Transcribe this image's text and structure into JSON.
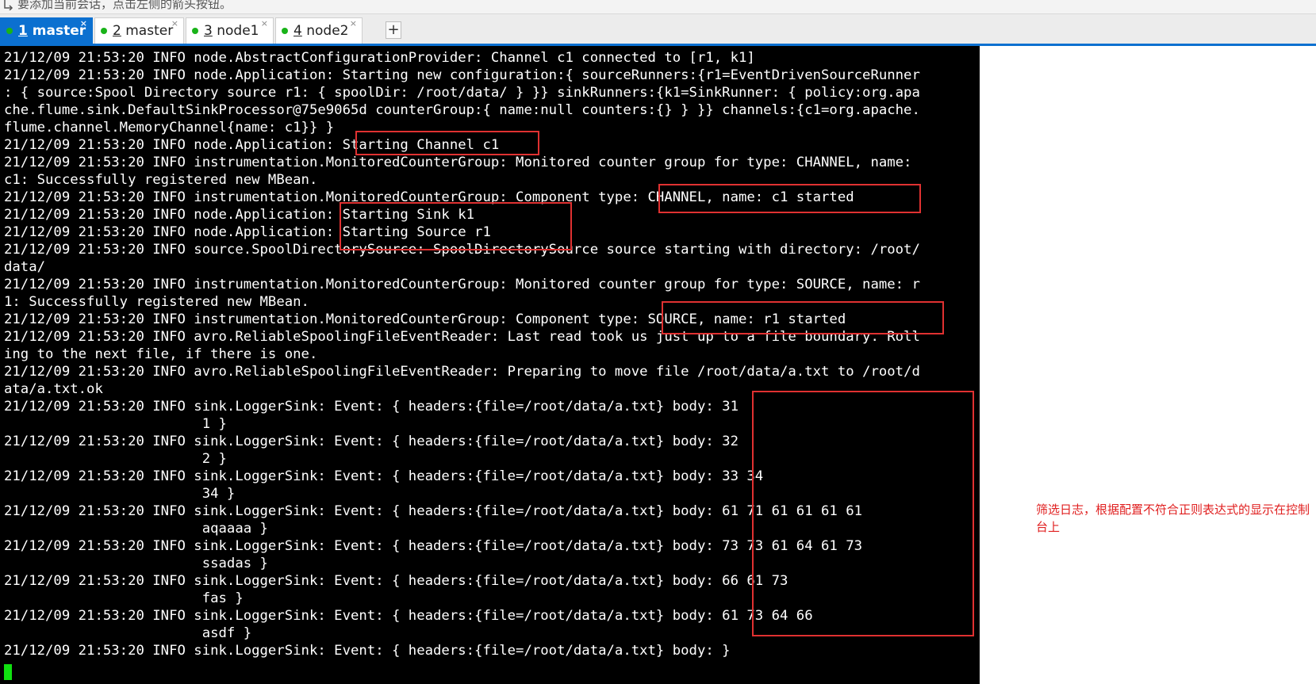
{
  "hint_bar": {
    "text": "要添加当前会话，点击左侧的箭头按钮。"
  },
  "tabs": [
    {
      "num": "1",
      "name": " master",
      "active": true
    },
    {
      "num": "2",
      "name": " master",
      "active": false
    },
    {
      "num": "3",
      "name": " node1",
      "active": false
    },
    {
      "num": "4",
      "name": " node2",
      "active": false
    }
  ],
  "tab_close_glyph": "×",
  "tab_add_glyph": "+",
  "terminal": {
    "lines": [
      "21/12/09 21:53:20 INFO node.AbstractConfigurationProvider: Channel c1 connected to [r1, k1]",
      "21/12/09 21:53:20 INFO node.Application: Starting new configuration:{ sourceRunners:{r1=EventDrivenSourceRunner",
      ": { source:Spool Directory source r1: { spoolDir: /root/data/ } }} sinkRunners:{k1=SinkRunner: { policy:org.apa",
      "che.flume.sink.DefaultSinkProcessor@75e9065d counterGroup:{ name:null counters:{} } }} channels:{c1=org.apache.",
      "flume.channel.MemoryChannel{name: c1}} }",
      "21/12/09 21:53:20 INFO node.Application: Starting Channel c1",
      "21/12/09 21:53:20 INFO instrumentation.MonitoredCounterGroup: Monitored counter group for type: CHANNEL, name:",
      "c1: Successfully registered new MBean.",
      "21/12/09 21:53:20 INFO instrumentation.MonitoredCounterGroup: Component type: CHANNEL, name: c1 started",
      "21/12/09 21:53:20 INFO node.Application: Starting Sink k1",
      "21/12/09 21:53:20 INFO node.Application: Starting Source r1",
      "21/12/09 21:53:20 INFO source.SpoolDirectorySource: SpoolDirectorySource source starting with directory: /root/",
      "data/",
      "21/12/09 21:53:20 INFO instrumentation.MonitoredCounterGroup: Monitored counter group for type: SOURCE, name: r",
      "1: Successfully registered new MBean.",
      "21/12/09 21:53:20 INFO instrumentation.MonitoredCounterGroup: Component type: SOURCE, name: r1 started",
      "21/12/09 21:53:20 INFO avro.ReliableSpoolingFileEventReader: Last read took us just up to a file boundary. Roll",
      "ing to the next file, if there is one.",
      "21/12/09 21:53:20 INFO avro.ReliableSpoolingFileEventReader: Preparing to move file /root/data/a.txt to /root/d",
      "ata/a.txt.ok",
      "21/12/09 21:53:20 INFO sink.LoggerSink: Event: { headers:{file=/root/data/a.txt} body: 31",
      "                        1 }",
      "21/12/09 21:53:20 INFO sink.LoggerSink: Event: { headers:{file=/root/data/a.txt} body: 32",
      "                        2 }",
      "21/12/09 21:53:20 INFO sink.LoggerSink: Event: { headers:{file=/root/data/a.txt} body: 33 34",
      "                        34 }",
      "21/12/09 21:53:20 INFO sink.LoggerSink: Event: { headers:{file=/root/data/a.txt} body: 61 71 61 61 61 61",
      "                        aqaaaa }",
      "21/12/09 21:53:20 INFO sink.LoggerSink: Event: { headers:{file=/root/data/a.txt} body: 73 73 61 64 61 73",
      "                        ssadas }",
      "21/12/09 21:53:20 INFO sink.LoggerSink: Event: { headers:{file=/root/data/a.txt} body: 66 61 73",
      "                        fas }",
      "21/12/09 21:53:20 INFO sink.LoggerSink: Event: { headers:{file=/root/data/a.txt} body: 61 73 64 66",
      "                        asdf }",
      "21/12/09 21:53:20 INFO sink.LoggerSink: Event: { headers:{file=/root/data/a.txt} body: }"
    ]
  },
  "annotation": {
    "text": "筛选日志，根据配置不符合正则表达式的显示在控制台上"
  },
  "colors": {
    "terminal_bg": "#000000",
    "terminal_fg": "#ffffff",
    "active_tab": "#0b70d0",
    "session_dot": "#19b319",
    "highlight": "#e03131",
    "cursor": "#10e010"
  }
}
